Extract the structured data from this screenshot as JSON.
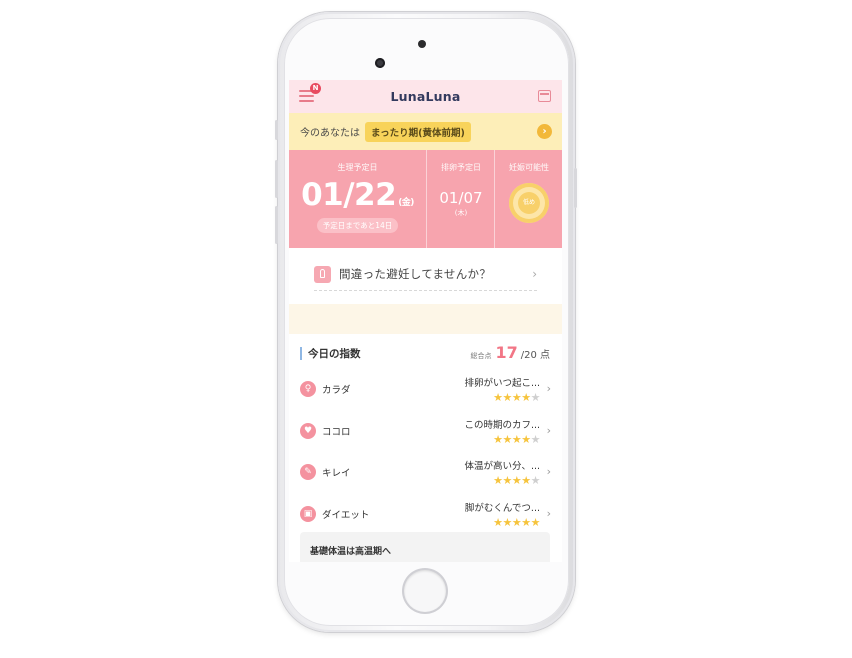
{
  "header": {
    "logo": "LunaLuna",
    "menu_badge": "N"
  },
  "state": {
    "label": "今のあなたは",
    "value": "まったり期(黄体前期)"
  },
  "forecast": {
    "period_title": "生理予定日",
    "period_date": "01/22",
    "period_day": "(金)",
    "period_remaining": "予定日まであと14日",
    "ovulation_title": "排卵予定日",
    "ovulation_date": "01/07",
    "ovulation_day": "(木)",
    "fertility_title": "妊娠可能性",
    "fertility_value": "低め"
  },
  "notice": {
    "text": "間違った避妊してませんか？"
  },
  "index": {
    "title": "今日の指数",
    "score_label": "総合点",
    "score": "17",
    "score_total": "/20 点",
    "items": [
      {
        "label": "カラダ",
        "desc": "排卵がいつ起こ...",
        "stars": 4
      },
      {
        "label": "ココロ",
        "desc": "この時期のカフ...",
        "stars": 4
      },
      {
        "label": "キレイ",
        "desc": "体温が高い分、...",
        "stars": 4
      },
      {
        "label": "ダイエット",
        "desc": "脚がむくんでつ...",
        "stars": 5
      }
    ]
  },
  "temperature_card": {
    "title": "基礎体温は高温期へ"
  },
  "colors": {
    "accent_pink": "#f7a4ae",
    "star": "#f6c43d",
    "state_bar": "#fdeeb8"
  }
}
